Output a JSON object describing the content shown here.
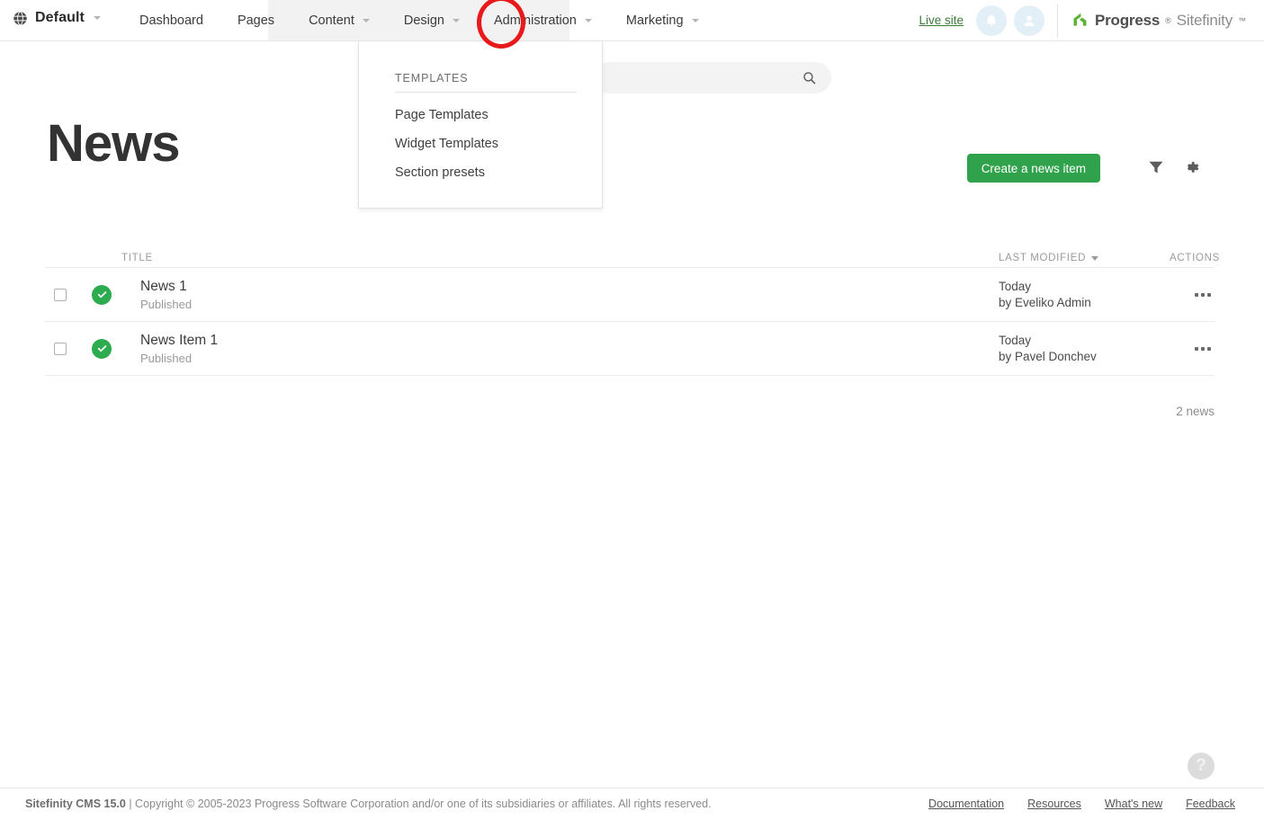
{
  "topnav": {
    "site_selector": {
      "label": "Default",
      "icon": "globe-icon"
    },
    "items": [
      {
        "label": "Dashboard",
        "has_caret": false
      },
      {
        "label": "Pages",
        "has_caret": false
      },
      {
        "label": "Content",
        "has_caret": true
      },
      {
        "label": "Design",
        "has_caret": true
      },
      {
        "label": "Administration",
        "has_caret": true
      },
      {
        "label": "Marketing",
        "has_caret": true
      }
    ],
    "live_site": "Live site",
    "notifications_icon": "bell-icon",
    "account_icon": "user-avatar-icon",
    "brand": {
      "progress": "Progress",
      "trademark": "®",
      "sitefinity": "Sitefinity",
      "trademark2": "™"
    }
  },
  "dropdown": {
    "section_title": "TEMPLATES",
    "items": [
      {
        "label": "Page Templates"
      },
      {
        "label": "Widget Templates"
      },
      {
        "label": "Section presets"
      }
    ]
  },
  "search": {
    "value": "",
    "placeholder": "",
    "icon": "search-icon"
  },
  "main": {
    "title": "News",
    "create_button": "Create a news item",
    "filter_icon": "filter-icon",
    "settings_icon": "gear-icon",
    "count_label": "2 news",
    "columns": {
      "title": "TITLE",
      "last_modified": "LAST MODIFIED",
      "actions": "ACTIONS"
    },
    "rows": [
      {
        "checked": false,
        "status_icon": "published-check-icon",
        "title": "News 1",
        "status": "Published",
        "modified_when": "Today",
        "modified_by": "by Eveliko Admin",
        "actions_icon": "more-actions-icon"
      },
      {
        "checked": false,
        "status_icon": "published-check-icon",
        "title": "News Item 1",
        "status": "Published",
        "modified_when": "Today",
        "modified_by": "by Pavel Donchev",
        "actions_icon": "more-actions-icon"
      }
    ]
  },
  "help": {
    "label": "?",
    "icon": "help-icon"
  },
  "footer": {
    "version": "Sitefinity CMS 15.0",
    "copyright": " | Copyright © 2005-2023 Progress Software Corporation and/or one of its subsidiaries or affiliates. All rights reserved.",
    "links": [
      {
        "label": "Documentation"
      },
      {
        "label": "Resources"
      },
      {
        "label": "What's new"
      },
      {
        "label": "Feedback"
      }
    ]
  },
  "annotation": {
    "shape": "red-circle-highlight",
    "target": "Administration"
  },
  "colors": {
    "accent_green": "#31a24c",
    "status_green": "#2dab4f",
    "annotation_red": "#e8191b",
    "nav_shade": "#f2f2f2"
  }
}
